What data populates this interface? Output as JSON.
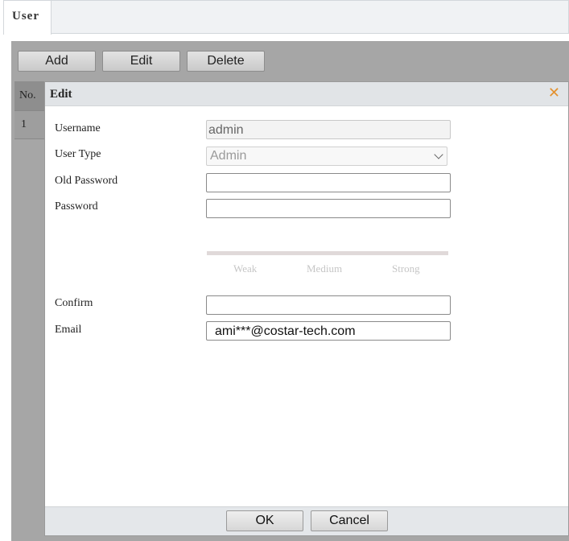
{
  "tabs": {
    "user": "User"
  },
  "toolbar": {
    "add_label": "Add",
    "edit_label": "Edit",
    "delete_label": "Delete"
  },
  "user_list": {
    "header_no": "No.",
    "rows": [
      {
        "no": "1"
      }
    ]
  },
  "dialog": {
    "title": "Edit",
    "close_icon": "close-icon",
    "fields": {
      "username": {
        "label": "Username",
        "value": "admin"
      },
      "user_type": {
        "label": "User Type",
        "value": "Admin"
      },
      "old_password": {
        "label": "Old Password",
        "value": ""
      },
      "password": {
        "label": "Password",
        "value": ""
      },
      "confirm": {
        "label": "Confirm",
        "value": ""
      },
      "email": {
        "label": "Email",
        "value": "ami***@costar-tech.com"
      }
    },
    "strength": {
      "weak": "Weak",
      "medium": "Medium",
      "strong": "Strong"
    },
    "ok_label": "OK",
    "cancel_label": "Cancel"
  },
  "colors": {
    "close_icon": "#e3912e",
    "overlay": "#a6a6a6"
  }
}
